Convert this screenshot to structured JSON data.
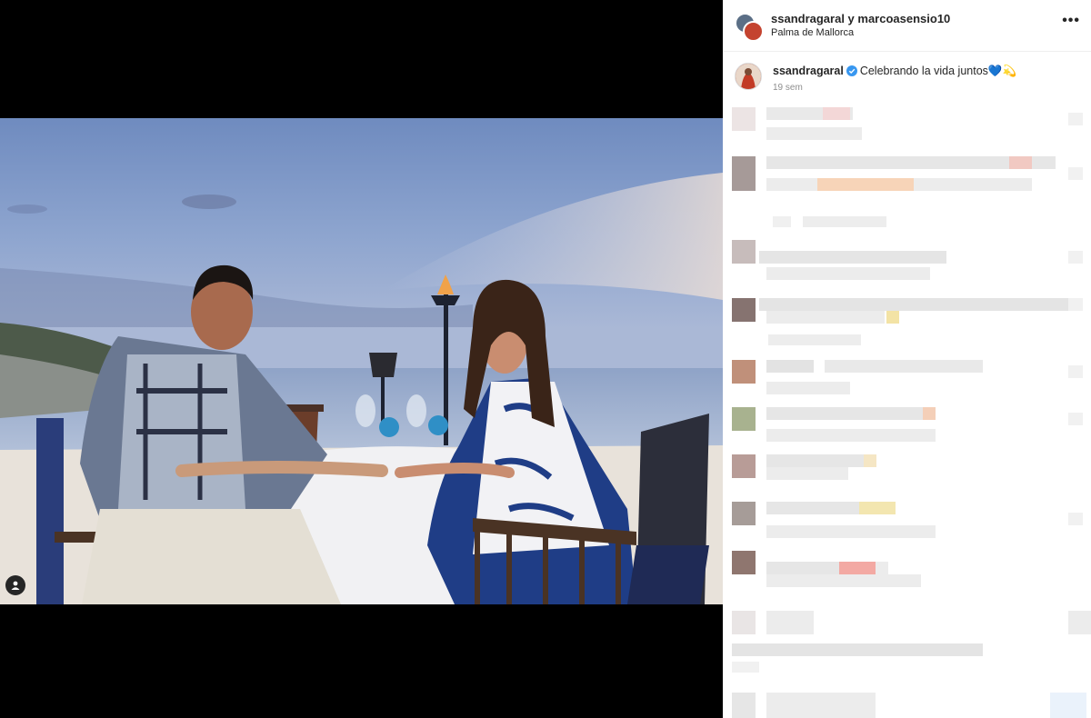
{
  "post": {
    "header": {
      "usernames": "ssandragaral y marcoasensio10",
      "location": "Palma de Mallorca",
      "more_icon": "more-horizontal-icon"
    },
    "caption": {
      "username": "ssandragaral",
      "verified_icon": "verified-badge-icon",
      "text": "Celebrando la vida juntos💙💫",
      "time": "19 sem"
    },
    "tag_icon": "user-tag-icon"
  },
  "colors": {
    "verified": "#3897f0",
    "text": "#262626",
    "muted": "#8e8e8e",
    "divider": "#efefef"
  }
}
